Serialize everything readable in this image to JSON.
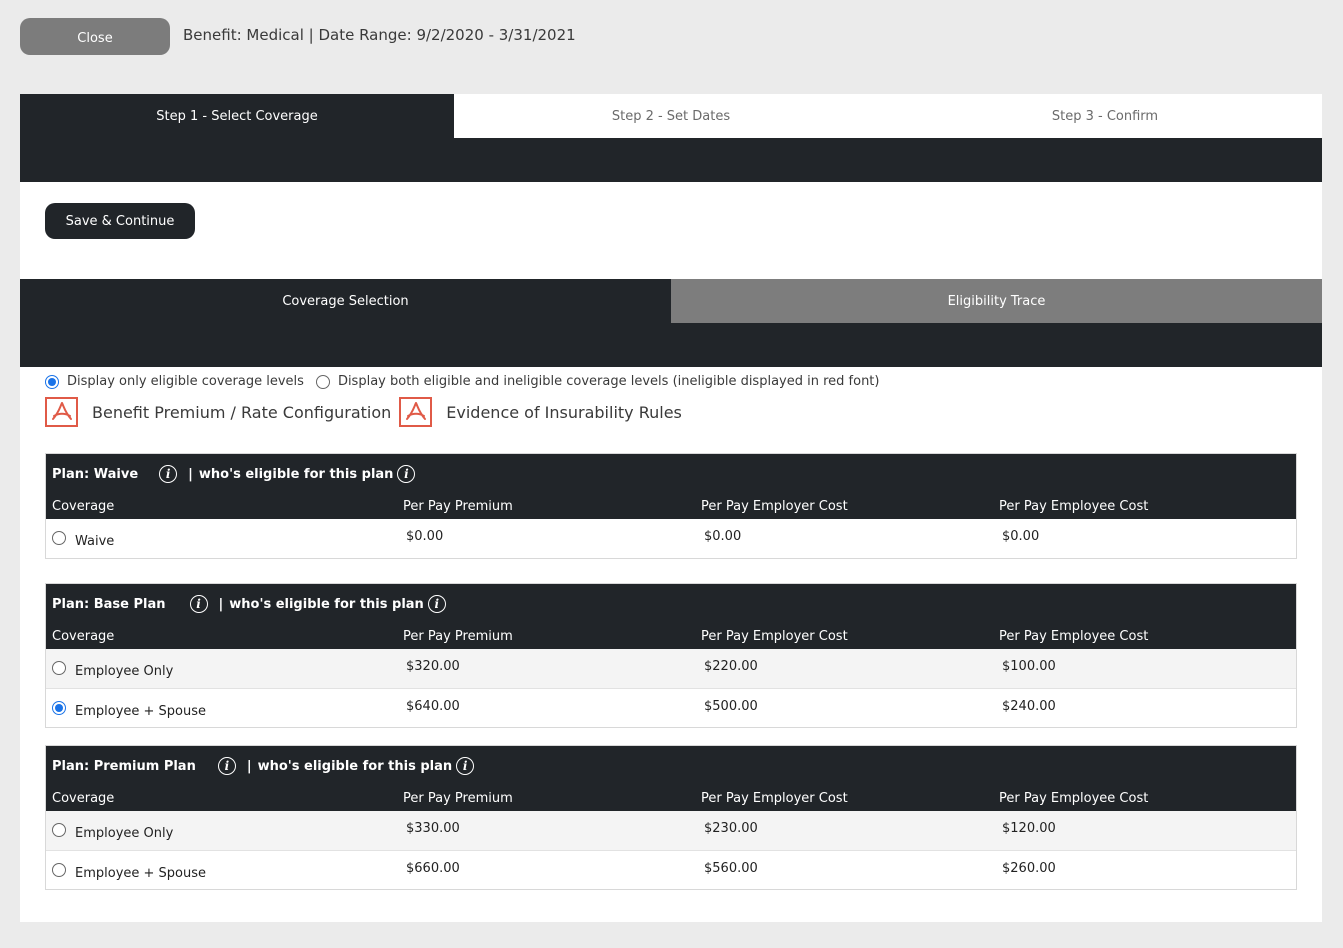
{
  "header": {
    "close_label": "Close",
    "benefit_info": "Benefit: Medical | Date Range: 9/2/2020 - 3/31/2021"
  },
  "steps": [
    {
      "label": "Step 1 - Select Coverage",
      "active": true
    },
    {
      "label": "Step 2 - Set Dates",
      "active": false
    },
    {
      "label": "Step 3 - Confirm",
      "active": false
    }
  ],
  "save_label": "Save & Continue",
  "tabs": [
    {
      "label": "Coverage Selection",
      "active": true
    },
    {
      "label": "Eligibility Trace",
      "active": false
    }
  ],
  "display_options": [
    {
      "label": "Display only eligible coverage levels",
      "checked": true
    },
    {
      "label": "Display both eligible and ineligible coverage levels (ineligible displayed in red font)",
      "checked": false
    }
  ],
  "doc_links": [
    {
      "label": "Benefit Premium / Rate Configuration",
      "icon": "pdf-icon"
    },
    {
      "label": "Evidence of Insurability Rules",
      "icon": "pdf-icon"
    }
  ],
  "columns": {
    "coverage": "Coverage",
    "premium": "Per Pay Premium",
    "employer": "Per Pay Employer Cost",
    "employee": "Per Pay Employee Cost"
  },
  "eligible_label": "who's eligible for this plan",
  "plans": [
    {
      "title": "Plan: Waive",
      "rows": [
        {
          "coverage": "Waive",
          "premium": "$0.00",
          "employer": "$0.00",
          "employee": "$0.00",
          "selected": false
        }
      ]
    },
    {
      "title": "Plan: Base Plan",
      "rows": [
        {
          "coverage": "Employee Only",
          "premium": "$320.00",
          "employer": "$220.00",
          "employee": "$100.00",
          "selected": false
        },
        {
          "coverage": "Employee + Spouse",
          "premium": "$640.00",
          "employer": "$500.00",
          "employee": "$240.00",
          "selected": true
        }
      ]
    },
    {
      "title": "Plan: Premium Plan",
      "rows": [
        {
          "coverage": "Employee Only",
          "premium": "$330.00",
          "employer": "$230.00",
          "employee": "$120.00",
          "selected": false
        },
        {
          "coverage": "Employee + Spouse",
          "premium": "$660.00",
          "employer": "$560.00",
          "employee": "$260.00",
          "selected": false
        }
      ]
    }
  ],
  "colors": {
    "dark": "#212529",
    "inactive_tab": "#7d7d7d",
    "radio_checked": "#1a73e8",
    "pdf_red": "#e05a47"
  }
}
